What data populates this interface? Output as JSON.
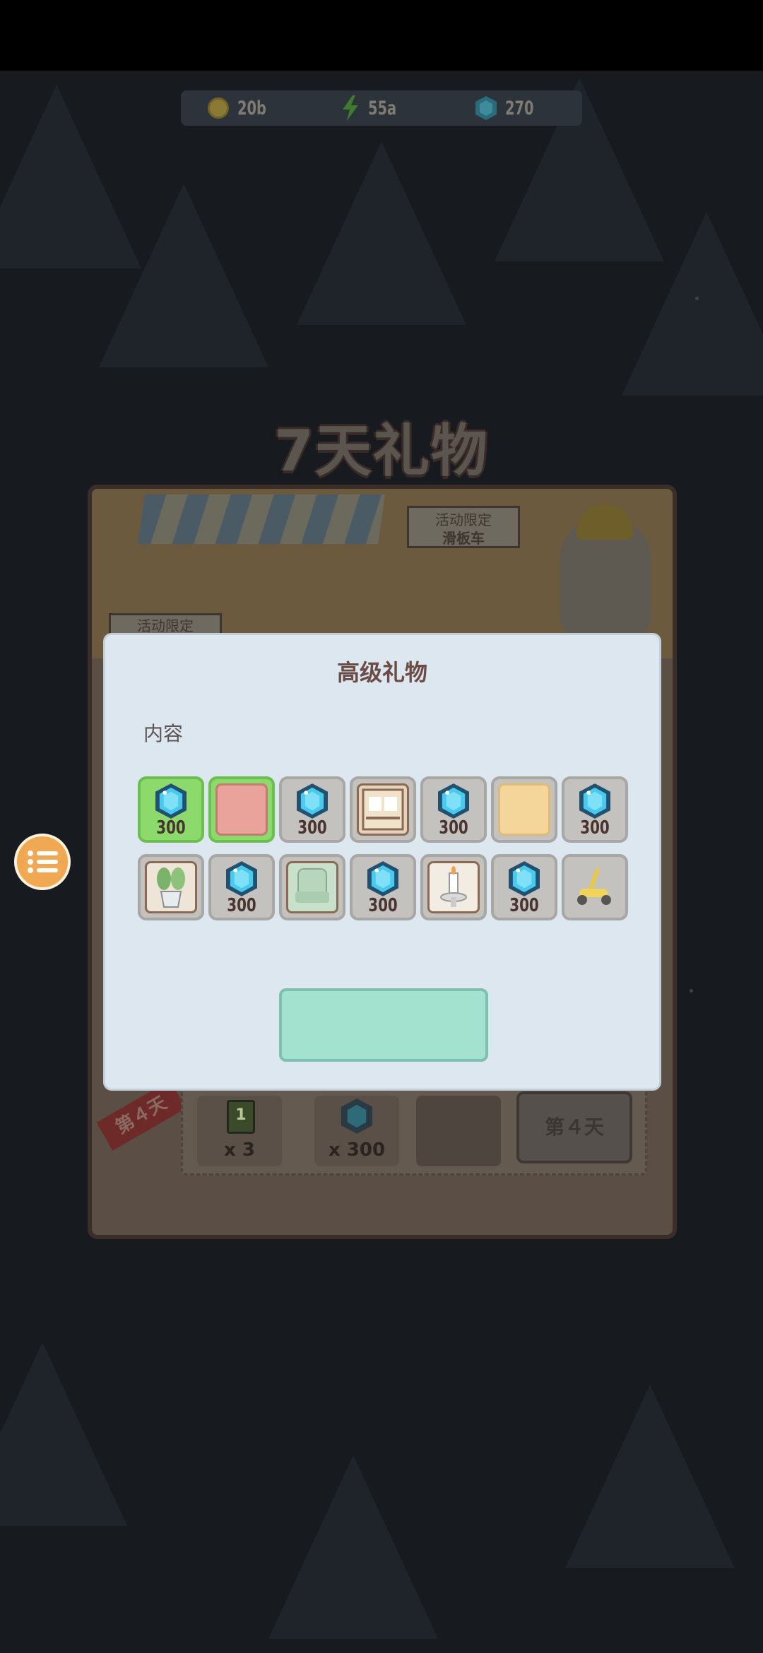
{
  "resources": {
    "coins": "20b",
    "energy": "55a",
    "gems": "270"
  },
  "screen_title": "7天礼物",
  "banner": {
    "sign_right_line1": "活动限定",
    "sign_right_line2": "滑板车",
    "sign_left": "活动限定"
  },
  "background_list": {
    "ribbon_label": "第４天",
    "row1": {
      "ticket_number": "1",
      "ticket_qty": "x 3",
      "gem_qty": "x 300",
      "day_button": "第４天"
    }
  },
  "modal": {
    "title": "高级礼物",
    "content_label": "内容",
    "items": [
      {
        "kind": "gem",
        "amount": "300",
        "selected": true
      },
      {
        "kind": "furniture-bed",
        "amount": "",
        "selected": true
      },
      {
        "kind": "gem",
        "amount": "300",
        "selected": false
      },
      {
        "kind": "furniture-cabinet",
        "amount": "",
        "selected": false
      },
      {
        "kind": "gem",
        "amount": "300",
        "selected": false
      },
      {
        "kind": "wallpaper",
        "amount": "",
        "selected": false
      },
      {
        "kind": "gem",
        "amount": "300",
        "selected": false
      },
      {
        "kind": "plant",
        "amount": "",
        "selected": false
      },
      {
        "kind": "gem",
        "amount": "300",
        "selected": false
      },
      {
        "kind": "furniture-chair",
        "amount": "",
        "selected": false
      },
      {
        "kind": "gem",
        "amount": "300",
        "selected": false
      },
      {
        "kind": "candle",
        "amount": "",
        "selected": false
      },
      {
        "kind": "gem",
        "amount": "300",
        "selected": false
      },
      {
        "kind": "scooter",
        "amount": "",
        "selected": false
      }
    ]
  },
  "colors": {
    "menu_button": "#f0a852",
    "modal_bg": "#dce7ef",
    "confirm_button": "#a3e2cf",
    "selected_item": "#8cd96c"
  }
}
